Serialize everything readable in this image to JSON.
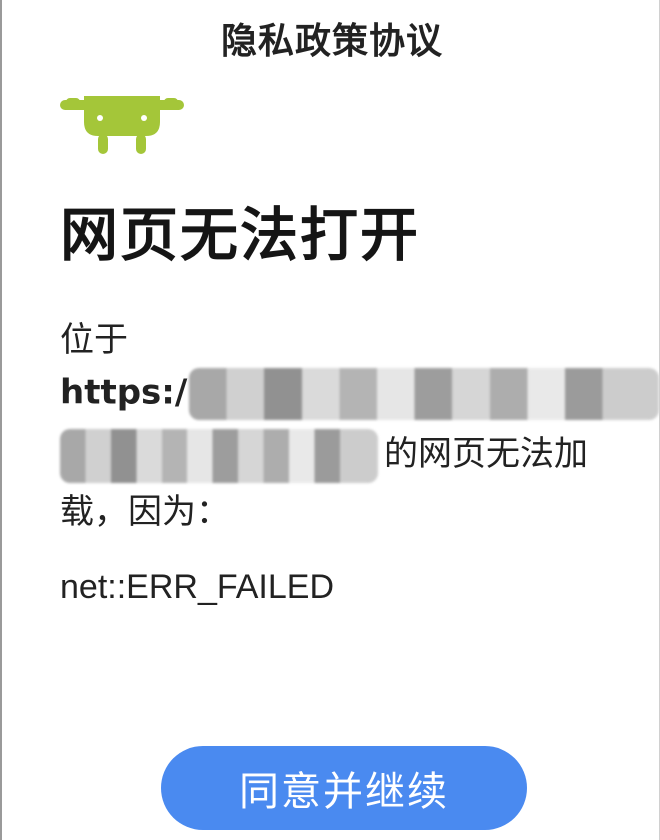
{
  "dialog": {
    "title": "隐私政策协议",
    "agree_button_label": "同意并继续"
  },
  "webview_error": {
    "icon": "android-robot-icon",
    "heading": "网页无法打开",
    "body_line_1": "位于",
    "url_prefix": "https:/",
    "body_suffix": "的网页无法加",
    "body_line_4": "载，因为：",
    "error_code": "net::ERR_FAILED"
  },
  "colors": {
    "accent_button": "#4a8af0",
    "android_green": "#a4c639"
  }
}
